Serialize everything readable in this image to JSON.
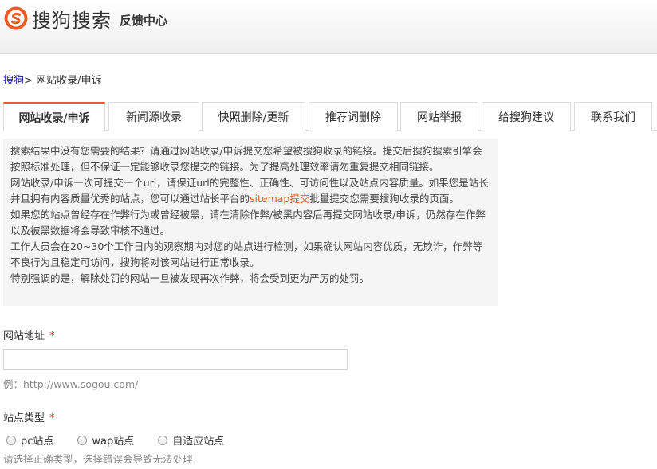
{
  "header": {
    "logo_text": "搜狗搜索",
    "subtitle": "反馈中心",
    "brand_color": "#f15a22"
  },
  "breadcrumb": {
    "home": "搜狗",
    "separator": ">",
    "current": "网站收录/申诉"
  },
  "tabs": [
    {
      "label": "网站收录/申诉",
      "active": true
    },
    {
      "label": "新闻源收录",
      "active": false
    },
    {
      "label": "快照删除/更新",
      "active": false
    },
    {
      "label": "推荐词删除",
      "active": false
    },
    {
      "label": "网站举报",
      "active": false
    },
    {
      "label": "给搜狗建议",
      "active": false
    },
    {
      "label": "联系我们",
      "active": false
    }
  ],
  "notice": {
    "p1": "搜索结果中没有您需要的结果？请通过网站收录/申诉提交您希望被搜狗收录的链接。提交后搜狗搜索引擎会按照标准处理，但不保证一定能够收录您提交的链接。为了提高处理效率请勿重复提交相同链接。",
    "p2_a": "网站收录/申诉一次可提交一个url，请保证url的完整性、正确性、可访问性以及站点内容质量。如果您是站长并且拥有内容质量优秀的站点，您可以通过站长平台的",
    "p2_link": "sitemap提交",
    "p2_b": "批量提交您需要搜狗收录的页面。",
    "p3": "如果您的站点曾经存在作弊行为或曾经被黑，请在清除作弊/被黑内容后再提交网站收录/申诉，仍然存在作弊以及被黑数据将会导致审核不通过。",
    "p4": "工作人员会在20~30个工作日内的观察期内对您的站点进行检测，如果确认网站内容优质，无欺诈，作弊等不良行为且稳定可访问，搜狗将对该网站进行正常收录。",
    "p5": "特别强调的是，解除处罚的网站一旦被发现再次作弊，将会受到更为严厉的处罚。"
  },
  "form": {
    "url_label": "网站地址",
    "required_mark": "*",
    "url_value": "",
    "url_hint": "例：http://www.sogou.com/",
    "type_label": "站点类型",
    "type_options": [
      "pc站点",
      "wap站点",
      "自适应站点"
    ],
    "type_hint": "请选择正确类型，选择错误会导致无法处理"
  }
}
